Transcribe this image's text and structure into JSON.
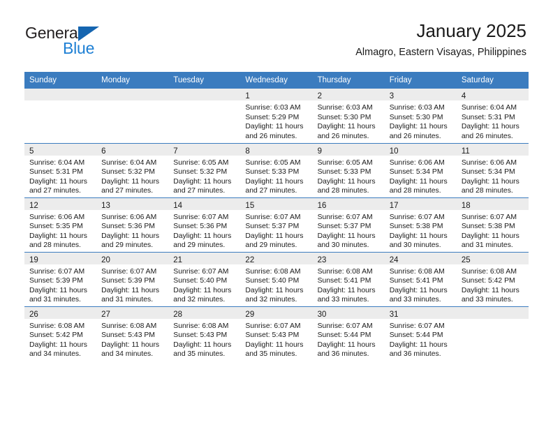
{
  "brand": {
    "name_part1": "General",
    "name_part2": "Blue",
    "triangle_color": "#1565b0",
    "blue_text_color": "#1d7fd4"
  },
  "header": {
    "title": "January 2025",
    "subtitle": "Almagro, Eastern Visayas, Philippines"
  },
  "theme": {
    "header_blue": "#3b7cbf",
    "daynum_band": "#ececec",
    "text": "#1a1a1a"
  },
  "columns": [
    "Sunday",
    "Monday",
    "Tuesday",
    "Wednesday",
    "Thursday",
    "Friday",
    "Saturday"
  ],
  "weeks": [
    [
      {
        "day": ""
      },
      {
        "day": ""
      },
      {
        "day": ""
      },
      {
        "day": "1",
        "sunrise": "Sunrise: 6:03 AM",
        "sunset": "Sunset: 5:29 PM",
        "daylight_1": "Daylight: 11 hours",
        "daylight_2": "and 26 minutes."
      },
      {
        "day": "2",
        "sunrise": "Sunrise: 6:03 AM",
        "sunset": "Sunset: 5:30 PM",
        "daylight_1": "Daylight: 11 hours",
        "daylight_2": "and 26 minutes."
      },
      {
        "day": "3",
        "sunrise": "Sunrise: 6:03 AM",
        "sunset": "Sunset: 5:30 PM",
        "daylight_1": "Daylight: 11 hours",
        "daylight_2": "and 26 minutes."
      },
      {
        "day": "4",
        "sunrise": "Sunrise: 6:04 AM",
        "sunset": "Sunset: 5:31 PM",
        "daylight_1": "Daylight: 11 hours",
        "daylight_2": "and 26 minutes."
      }
    ],
    [
      {
        "day": "5",
        "sunrise": "Sunrise: 6:04 AM",
        "sunset": "Sunset: 5:31 PM",
        "daylight_1": "Daylight: 11 hours",
        "daylight_2": "and 27 minutes."
      },
      {
        "day": "6",
        "sunrise": "Sunrise: 6:04 AM",
        "sunset": "Sunset: 5:32 PM",
        "daylight_1": "Daylight: 11 hours",
        "daylight_2": "and 27 minutes."
      },
      {
        "day": "7",
        "sunrise": "Sunrise: 6:05 AM",
        "sunset": "Sunset: 5:32 PM",
        "daylight_1": "Daylight: 11 hours",
        "daylight_2": "and 27 minutes."
      },
      {
        "day": "8",
        "sunrise": "Sunrise: 6:05 AM",
        "sunset": "Sunset: 5:33 PM",
        "daylight_1": "Daylight: 11 hours",
        "daylight_2": "and 27 minutes."
      },
      {
        "day": "9",
        "sunrise": "Sunrise: 6:05 AM",
        "sunset": "Sunset: 5:33 PM",
        "daylight_1": "Daylight: 11 hours",
        "daylight_2": "and 28 minutes."
      },
      {
        "day": "10",
        "sunrise": "Sunrise: 6:06 AM",
        "sunset": "Sunset: 5:34 PM",
        "daylight_1": "Daylight: 11 hours",
        "daylight_2": "and 28 minutes."
      },
      {
        "day": "11",
        "sunrise": "Sunrise: 6:06 AM",
        "sunset": "Sunset: 5:34 PM",
        "daylight_1": "Daylight: 11 hours",
        "daylight_2": "and 28 minutes."
      }
    ],
    [
      {
        "day": "12",
        "sunrise": "Sunrise: 6:06 AM",
        "sunset": "Sunset: 5:35 PM",
        "daylight_1": "Daylight: 11 hours",
        "daylight_2": "and 28 minutes."
      },
      {
        "day": "13",
        "sunrise": "Sunrise: 6:06 AM",
        "sunset": "Sunset: 5:36 PM",
        "daylight_1": "Daylight: 11 hours",
        "daylight_2": "and 29 minutes."
      },
      {
        "day": "14",
        "sunrise": "Sunrise: 6:07 AM",
        "sunset": "Sunset: 5:36 PM",
        "daylight_1": "Daylight: 11 hours",
        "daylight_2": "and 29 minutes."
      },
      {
        "day": "15",
        "sunrise": "Sunrise: 6:07 AM",
        "sunset": "Sunset: 5:37 PM",
        "daylight_1": "Daylight: 11 hours",
        "daylight_2": "and 29 minutes."
      },
      {
        "day": "16",
        "sunrise": "Sunrise: 6:07 AM",
        "sunset": "Sunset: 5:37 PM",
        "daylight_1": "Daylight: 11 hours",
        "daylight_2": "and 30 minutes."
      },
      {
        "day": "17",
        "sunrise": "Sunrise: 6:07 AM",
        "sunset": "Sunset: 5:38 PM",
        "daylight_1": "Daylight: 11 hours",
        "daylight_2": "and 30 minutes."
      },
      {
        "day": "18",
        "sunrise": "Sunrise: 6:07 AM",
        "sunset": "Sunset: 5:38 PM",
        "daylight_1": "Daylight: 11 hours",
        "daylight_2": "and 31 minutes."
      }
    ],
    [
      {
        "day": "19",
        "sunrise": "Sunrise: 6:07 AM",
        "sunset": "Sunset: 5:39 PM",
        "daylight_1": "Daylight: 11 hours",
        "daylight_2": "and 31 minutes."
      },
      {
        "day": "20",
        "sunrise": "Sunrise: 6:07 AM",
        "sunset": "Sunset: 5:39 PM",
        "daylight_1": "Daylight: 11 hours",
        "daylight_2": "and 31 minutes."
      },
      {
        "day": "21",
        "sunrise": "Sunrise: 6:07 AM",
        "sunset": "Sunset: 5:40 PM",
        "daylight_1": "Daylight: 11 hours",
        "daylight_2": "and 32 minutes."
      },
      {
        "day": "22",
        "sunrise": "Sunrise: 6:08 AM",
        "sunset": "Sunset: 5:40 PM",
        "daylight_1": "Daylight: 11 hours",
        "daylight_2": "and 32 minutes."
      },
      {
        "day": "23",
        "sunrise": "Sunrise: 6:08 AM",
        "sunset": "Sunset: 5:41 PM",
        "daylight_1": "Daylight: 11 hours",
        "daylight_2": "and 33 minutes."
      },
      {
        "day": "24",
        "sunrise": "Sunrise: 6:08 AM",
        "sunset": "Sunset: 5:41 PM",
        "daylight_1": "Daylight: 11 hours",
        "daylight_2": "and 33 minutes."
      },
      {
        "day": "25",
        "sunrise": "Sunrise: 6:08 AM",
        "sunset": "Sunset: 5:42 PM",
        "daylight_1": "Daylight: 11 hours",
        "daylight_2": "and 33 minutes."
      }
    ],
    [
      {
        "day": "26",
        "sunrise": "Sunrise: 6:08 AM",
        "sunset": "Sunset: 5:42 PM",
        "daylight_1": "Daylight: 11 hours",
        "daylight_2": "and 34 minutes."
      },
      {
        "day": "27",
        "sunrise": "Sunrise: 6:08 AM",
        "sunset": "Sunset: 5:43 PM",
        "daylight_1": "Daylight: 11 hours",
        "daylight_2": "and 34 minutes."
      },
      {
        "day": "28",
        "sunrise": "Sunrise: 6:08 AM",
        "sunset": "Sunset: 5:43 PM",
        "daylight_1": "Daylight: 11 hours",
        "daylight_2": "and 35 minutes."
      },
      {
        "day": "29",
        "sunrise": "Sunrise: 6:07 AM",
        "sunset": "Sunset: 5:43 PM",
        "daylight_1": "Daylight: 11 hours",
        "daylight_2": "and 35 minutes."
      },
      {
        "day": "30",
        "sunrise": "Sunrise: 6:07 AM",
        "sunset": "Sunset: 5:44 PM",
        "daylight_1": "Daylight: 11 hours",
        "daylight_2": "and 36 minutes."
      },
      {
        "day": "31",
        "sunrise": "Sunrise: 6:07 AM",
        "sunset": "Sunset: 5:44 PM",
        "daylight_1": "Daylight: 11 hours",
        "daylight_2": "and 36 minutes."
      },
      {
        "day": ""
      }
    ]
  ]
}
